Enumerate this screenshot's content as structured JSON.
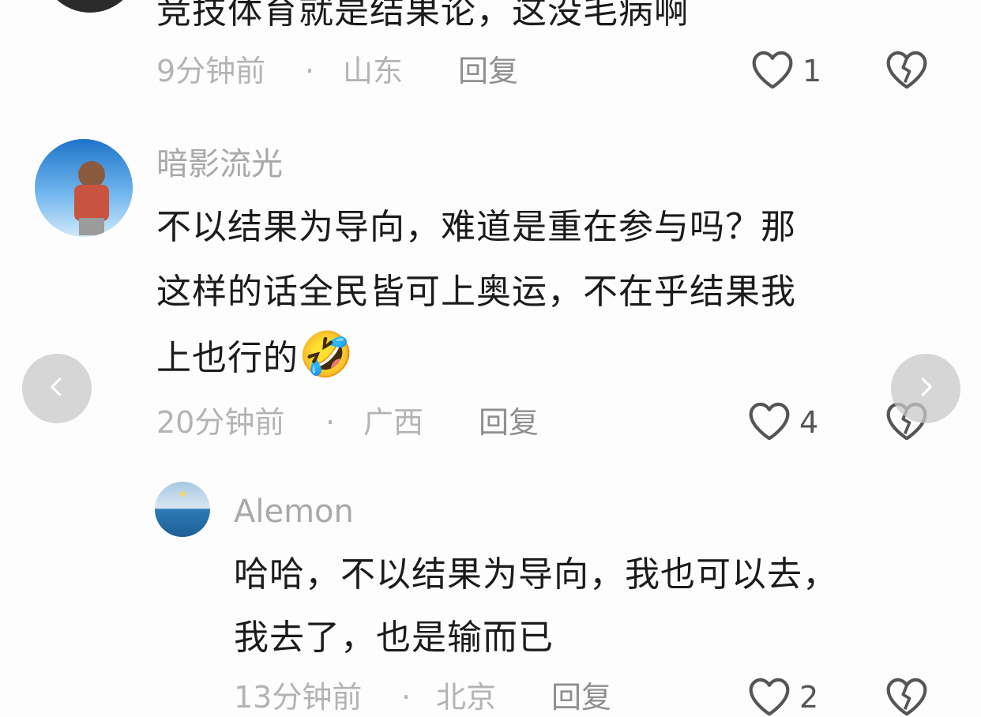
{
  "comments": [
    {
      "text_lines": [
        "竞技体育就是结果论，这没毛病啊"
      ],
      "time": "9分钟前",
      "separator": "·",
      "location": "山东",
      "reply_label": "回复",
      "likes": "1"
    },
    {
      "username": "暗影流光",
      "text_lines": [
        "不以结果为导向，难道是重在参与吗？那",
        "这样的话全民皆可上奥运，不在乎结果我",
        "上也行的"
      ],
      "emoji": "🤣",
      "time": "20分钟前",
      "separator": "·",
      "location": "广西",
      "reply_label": "回复",
      "likes": "4"
    },
    {
      "username": "Alemon",
      "text_lines": [
        "哈哈，不以结果为导向，我也可以去，",
        "我去了，也是输而已"
      ],
      "time": "13分钟前",
      "separator": "·",
      "location": "北京",
      "reply_label": "回复",
      "likes": "2"
    }
  ],
  "icons": {
    "like": "heart-outline-icon",
    "dislike": "broken-heart-icon",
    "prev": "chevron-left-icon",
    "next": "chevron-right-icon"
  },
  "colors": {
    "text": "#1b1b1b",
    "meta": "#b4b4b4",
    "icon": "#555555"
  }
}
